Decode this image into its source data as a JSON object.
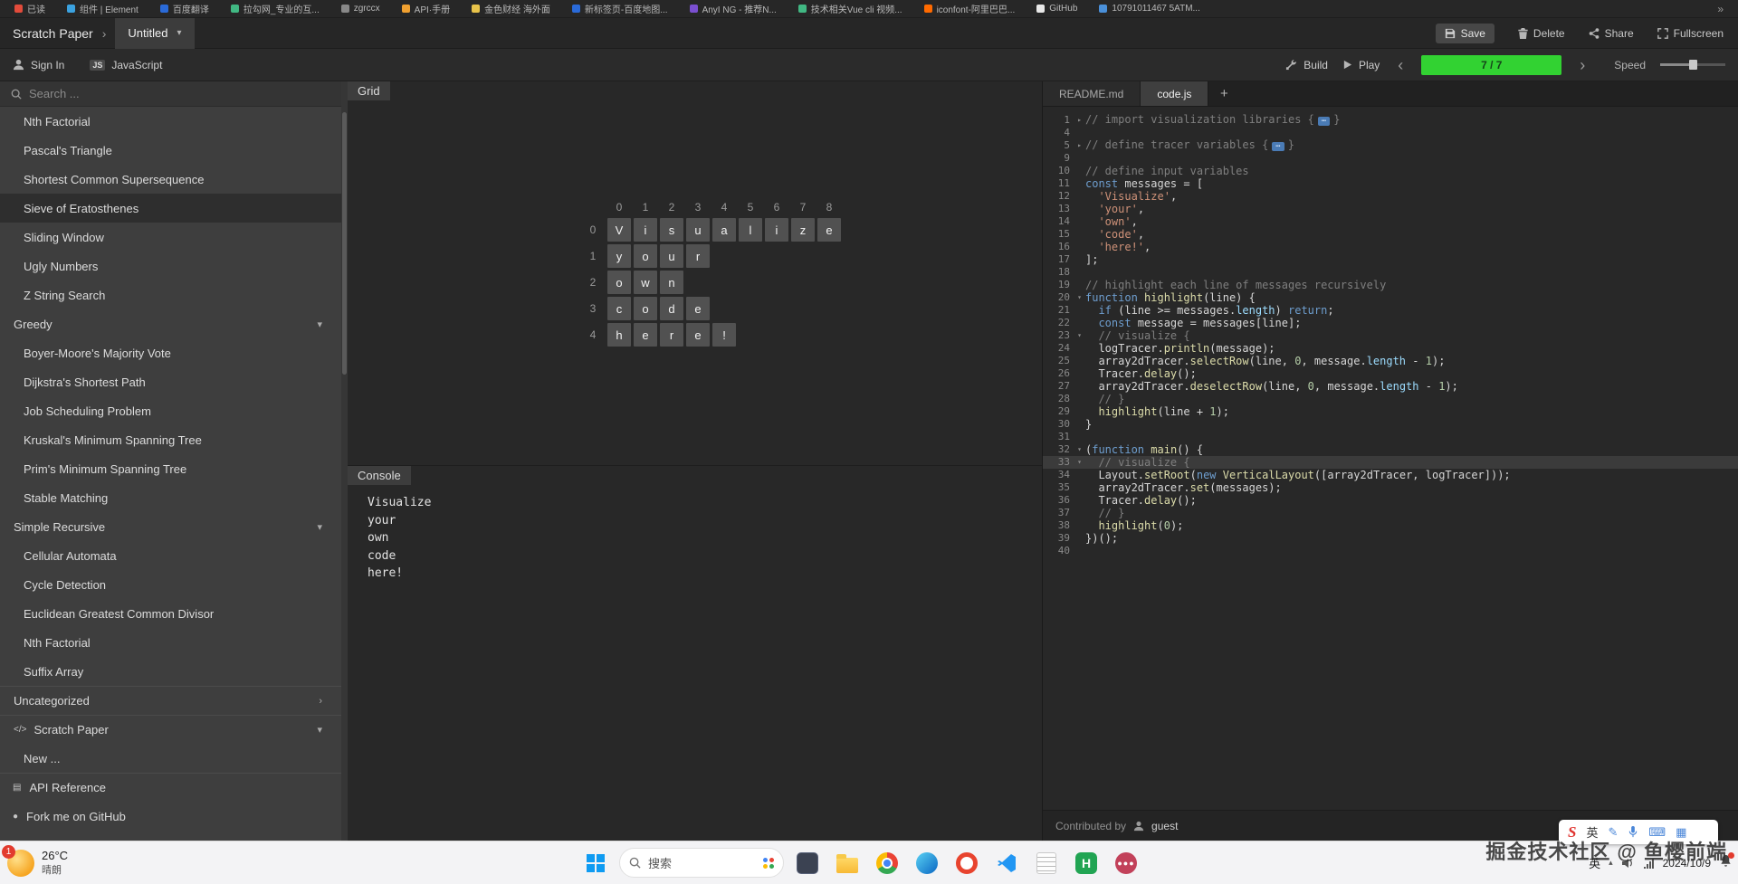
{
  "bookmarks": {
    "overflow": "»",
    "items": [
      {
        "label": "已读",
        "color": "#e24b3b"
      },
      {
        "label": "组件 | Element",
        "color": "#3ba2e0"
      },
      {
        "label": "百度翻译",
        "color": "#2a6ad8"
      },
      {
        "label": "拉勾网_专业的互...",
        "color": "#41b883"
      },
      {
        "label": "zgrccx",
        "color": "#888888"
      },
      {
        "label": "API·手册",
        "color": "#f0a030"
      },
      {
        "label": "金色财经 海外面",
        "color": "#e8c34a"
      },
      {
        "label": "新标签页-百度地图...",
        "color": "#2a6ad8"
      },
      {
        "label": "AnyI NG - 推荐N...",
        "color": "#7a4fd0"
      },
      {
        "label": "技术相关Vue cli 视频...",
        "color": "#41b883"
      },
      {
        "label": "iconfont-阿里巴巴...",
        "color": "#ff6a00"
      },
      {
        "label": "GitHub",
        "color": "#e8e8e8"
      },
      {
        "label": "10791011467 5ATM...",
        "color": "#4a90d9"
      }
    ]
  },
  "header": {
    "breadcrumb": "Scratch Paper",
    "crumb_sep": "›",
    "tab": "Untitled",
    "tab_caret": "▾",
    "actions": {
      "save": "Save",
      "delete": "Delete",
      "share": "Share",
      "fullscreen": "Fullscreen"
    }
  },
  "toolbar": {
    "sign_in": "Sign In",
    "language": "JavaScript",
    "language_badge": "JS",
    "build": "Build",
    "play": "Play",
    "prev": "‹",
    "next": "›",
    "progress": "7 / 7",
    "progress_color": "#32d232",
    "speed_label": "Speed"
  },
  "sidebar": {
    "search_placeholder": "Search ...",
    "entries": [
      {
        "kind": "item",
        "label": "Nth Factorial"
      },
      {
        "kind": "item",
        "label": "Pascal's Triangle"
      },
      {
        "kind": "item",
        "label": "Shortest Common Supersequence"
      },
      {
        "kind": "item",
        "label": "Sieve of Eratosthenes",
        "selected": true
      },
      {
        "kind": "item",
        "label": "Sliding Window"
      },
      {
        "kind": "item",
        "label": "Ugly Numbers"
      },
      {
        "kind": "item",
        "label": "Z String Search"
      },
      {
        "kind": "category",
        "label": "Greedy",
        "chevron": "▾"
      },
      {
        "kind": "item",
        "label": "Boyer-Moore's Majority Vote"
      },
      {
        "kind": "item",
        "label": "Dijkstra's Shortest Path"
      },
      {
        "kind": "item",
        "label": "Job Scheduling Problem"
      },
      {
        "kind": "item",
        "label": "Kruskal's Minimum Spanning Tree"
      },
      {
        "kind": "item",
        "label": "Prim's Minimum Spanning Tree"
      },
      {
        "kind": "item",
        "label": "Stable Matching"
      },
      {
        "kind": "category",
        "label": "Simple Recursive",
        "chevron": "▾"
      },
      {
        "kind": "item",
        "label": "Cellular Automata"
      },
      {
        "kind": "item",
        "label": "Cycle Detection"
      },
      {
        "kind": "item",
        "label": "Euclidean Greatest Common Divisor"
      },
      {
        "kind": "item",
        "label": "Nth Factorial"
      },
      {
        "kind": "item",
        "label": "Suffix Array"
      },
      {
        "kind": "category",
        "label": "Uncategorized",
        "chevron": "›",
        "sep": true
      },
      {
        "kind": "category",
        "label": "Scratch Paper",
        "chevron": "▾",
        "icon": "code",
        "sep": true
      },
      {
        "kind": "item",
        "label": "New ..."
      },
      {
        "kind": "footer",
        "label": "API Reference",
        "icon": "doc",
        "sep": true
      },
      {
        "kind": "footer",
        "label": "Fork me on GitHub",
        "icon": "github"
      }
    ]
  },
  "visualizer": {
    "grid_label": "Grid",
    "console_label": "Console",
    "grid": {
      "col_headers": [
        "0",
        "1",
        "2",
        "3",
        "4",
        "5",
        "6",
        "7",
        "8"
      ],
      "rows": [
        {
          "header": "0",
          "cells": [
            "V",
            "i",
            "s",
            "u",
            "a",
            "l",
            "i",
            "z",
            "e"
          ]
        },
        {
          "header": "1",
          "cells": [
            "y",
            "o",
            "u",
            "r"
          ]
        },
        {
          "header": "2",
          "cells": [
            "o",
            "w",
            "n"
          ]
        },
        {
          "header": "3",
          "cells": [
            "c",
            "o",
            "d",
            "e"
          ]
        },
        {
          "header": "4",
          "cells": [
            "h",
            "e",
            "r",
            "e",
            "!"
          ]
        }
      ]
    },
    "console_lines": [
      "Visualize",
      "your",
      "own",
      "code",
      "here!"
    ]
  },
  "editor": {
    "tabs": [
      {
        "label": "README.md",
        "active": false
      },
      {
        "label": "code.js",
        "active": true
      }
    ],
    "add_tab": "+",
    "contributed_by": "Contributed by",
    "author": "guest",
    "lines": [
      {
        "n": 1,
        "fold": "▸",
        "tokens": [
          [
            "cm",
            "// import visualization libraries {"
          ],
          [
            "badge",
            "⋯"
          ],
          [
            "cm",
            "}"
          ]
        ]
      },
      {
        "n": 4,
        "tokens": []
      },
      {
        "n": 5,
        "fold": "▸",
        "tokens": [
          [
            "cm",
            "// define tracer variables {"
          ],
          [
            "badge",
            "⋯"
          ],
          [
            "cm",
            "}"
          ]
        ]
      },
      {
        "n": 9,
        "tokens": []
      },
      {
        "n": 10,
        "tokens": [
          [
            "cm",
            "// define input variables"
          ]
        ]
      },
      {
        "n": 11,
        "tokens": [
          [
            "kw",
            "const"
          ],
          [
            "pl",
            " messages = ["
          ]
        ]
      },
      {
        "n": 12,
        "tokens": [
          [
            "pl",
            "  "
          ],
          [
            "str",
            "'Visualize'"
          ],
          [
            "pl",
            ","
          ]
        ]
      },
      {
        "n": 13,
        "tokens": [
          [
            "pl",
            "  "
          ],
          [
            "str",
            "'your'"
          ],
          [
            "pl",
            ","
          ]
        ]
      },
      {
        "n": 14,
        "tokens": [
          [
            "pl",
            "  "
          ],
          [
            "str",
            "'own'"
          ],
          [
            "pl",
            ","
          ]
        ]
      },
      {
        "n": 15,
        "tokens": [
          [
            "pl",
            "  "
          ],
          [
            "str",
            "'code'"
          ],
          [
            "pl",
            ","
          ]
        ]
      },
      {
        "n": 16,
        "tokens": [
          [
            "pl",
            "  "
          ],
          [
            "str",
            "'here!'"
          ],
          [
            "pl",
            ","
          ]
        ]
      },
      {
        "n": 17,
        "tokens": [
          [
            "pl",
            "];"
          ]
        ]
      },
      {
        "n": 18,
        "tokens": []
      },
      {
        "n": 19,
        "tokens": [
          [
            "cm",
            "// highlight each line of messages recursively"
          ]
        ]
      },
      {
        "n": 20,
        "fold": "▾",
        "tokens": [
          [
            "kw",
            "function"
          ],
          [
            "pl",
            " "
          ],
          [
            "fn",
            "highlight"
          ],
          [
            "pl",
            "(line) {"
          ]
        ]
      },
      {
        "n": 21,
        "tokens": [
          [
            "pl",
            "  "
          ],
          [
            "kw",
            "if"
          ],
          [
            "pl",
            " (line >= messages."
          ],
          [
            "prop",
            "length"
          ],
          [
            "pl",
            ") "
          ],
          [
            "kw",
            "return"
          ],
          [
            "pl",
            ";"
          ]
        ]
      },
      {
        "n": 22,
        "tokens": [
          [
            "pl",
            "  "
          ],
          [
            "kw",
            "const"
          ],
          [
            "pl",
            " message = messages[line];"
          ]
        ]
      },
      {
        "n": 23,
        "fold": "▾",
        "tokens": [
          [
            "pl",
            "  "
          ],
          [
            "cm",
            "// visualize {"
          ]
        ]
      },
      {
        "n": 24,
        "tokens": [
          [
            "pl",
            "  logTracer."
          ],
          [
            "fn",
            "println"
          ],
          [
            "pl",
            "(message);"
          ]
        ]
      },
      {
        "n": 25,
        "tokens": [
          [
            "pl",
            "  array2dTracer."
          ],
          [
            "fn",
            "selectRow"
          ],
          [
            "pl",
            "(line, "
          ],
          [
            "num",
            "0"
          ],
          [
            "pl",
            ", message."
          ],
          [
            "prop",
            "length"
          ],
          [
            "pl",
            " - "
          ],
          [
            "num",
            "1"
          ],
          [
            "pl",
            ");"
          ]
        ]
      },
      {
        "n": 26,
        "tokens": [
          [
            "pl",
            "  Tracer."
          ],
          [
            "fn",
            "delay"
          ],
          [
            "pl",
            "();"
          ]
        ]
      },
      {
        "n": 27,
        "tokens": [
          [
            "pl",
            "  array2dTracer."
          ],
          [
            "fn",
            "deselectRow"
          ],
          [
            "pl",
            "(line, "
          ],
          [
            "num",
            "0"
          ],
          [
            "pl",
            ", message."
          ],
          [
            "prop",
            "length"
          ],
          [
            "pl",
            " - "
          ],
          [
            "num",
            "1"
          ],
          [
            "pl",
            ");"
          ]
        ]
      },
      {
        "n": 28,
        "tokens": [
          [
            "pl",
            "  "
          ],
          [
            "cm",
            "// }"
          ]
        ]
      },
      {
        "n": 29,
        "tokens": [
          [
            "pl",
            "  "
          ],
          [
            "fn",
            "highlight"
          ],
          [
            "pl",
            "(line + "
          ],
          [
            "num",
            "1"
          ],
          [
            "pl",
            ");"
          ]
        ]
      },
      {
        "n": 30,
        "tokens": [
          [
            "pl",
            "}"
          ]
        ]
      },
      {
        "n": 31,
        "tokens": []
      },
      {
        "n": 32,
        "fold": "▾",
        "tokens": [
          [
            "pl",
            "("
          ],
          [
            "kw",
            "function"
          ],
          [
            "pl",
            " "
          ],
          [
            "fn",
            "main"
          ],
          [
            "pl",
            "() {"
          ]
        ]
      },
      {
        "n": 33,
        "fold": "▾",
        "active": true,
        "tokens": [
          [
            "pl",
            "  "
          ],
          [
            "cm",
            "// visualize {"
          ]
        ]
      },
      {
        "n": 34,
        "tokens": [
          [
            "pl",
            "  Layout."
          ],
          [
            "fn",
            "setRoot"
          ],
          [
            "pl",
            "("
          ],
          [
            "kw",
            "new"
          ],
          [
            "pl",
            " "
          ],
          [
            "fn",
            "VerticalLayout"
          ],
          [
            "pl",
            "([array2dTracer, logTracer]));"
          ]
        ]
      },
      {
        "n": 35,
        "tokens": [
          [
            "pl",
            "  array2dTracer."
          ],
          [
            "fn",
            "set"
          ],
          [
            "pl",
            "(messages);"
          ]
        ]
      },
      {
        "n": 36,
        "tokens": [
          [
            "pl",
            "  Tracer."
          ],
          [
            "fn",
            "delay"
          ],
          [
            "pl",
            "();"
          ]
        ]
      },
      {
        "n": 37,
        "tokens": [
          [
            "pl",
            "  "
          ],
          [
            "cm",
            "// }"
          ]
        ]
      },
      {
        "n": 38,
        "tokens": [
          [
            "pl",
            "  "
          ],
          [
            "fn",
            "highlight"
          ],
          [
            "pl",
            "("
          ],
          [
            "num",
            "0"
          ],
          [
            "pl",
            ");"
          ]
        ]
      },
      {
        "n": 39,
        "tokens": [
          [
            "pl",
            "})();"
          ]
        ]
      },
      {
        "n": 40,
        "tokens": []
      }
    ]
  },
  "taskbar": {
    "weather_temp": "26°C",
    "weather_desc": "晴朗",
    "weather_badge": "1",
    "search_label": "搜索",
    "tray_lang": "英",
    "tray_caret": "▴",
    "date": "2024/10/9"
  },
  "ime": {
    "logo": "S",
    "lang": "英",
    "icons": [
      "✎",
      "⌨",
      "▦"
    ]
  },
  "watermark": "掘金技术社区 @ 鱼樱前端"
}
